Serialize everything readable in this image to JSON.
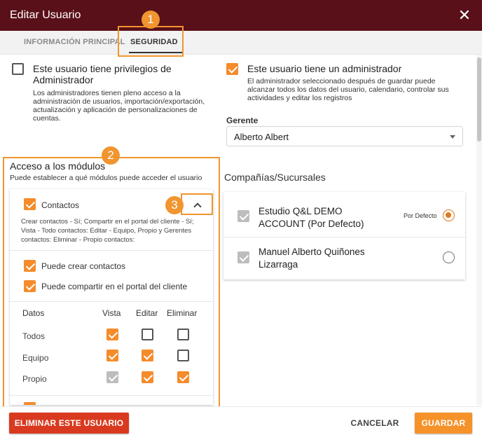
{
  "window": {
    "title": "Editar Usuario",
    "close_glyph": "✕"
  },
  "tabs": [
    {
      "label": "INFORMACIÓN PRINCIPAL",
      "active": false
    },
    {
      "label": "SEGURIDAD",
      "active": true
    }
  ],
  "admin_privileges": {
    "checked": false,
    "label_line1": "Este usuario tiene privilegios de",
    "label_line2": "Administrador",
    "description": "Los administradores tienen pleno acceso a la administración de usuarios, importación/exportación, actualización y aplicación de personalizaciones de cuentas."
  },
  "has_admin": {
    "checked": true,
    "label": "Este usuario tiene un administrador",
    "description": "El administrador seleccionado después de guardar puede alcanzar todos los datos del usuario, calendario, controlar sus actividades y editar los registros"
  },
  "manager": {
    "label": "Gerente",
    "value": "Alberto Albert"
  },
  "modules": {
    "title": "Acceso a los módulos",
    "subtitle": "Puede establecer a qué módulos puede acceder el usuario",
    "module_name": "Contactos",
    "module_checked": true,
    "summary": "Crear contactos - Sí; Compartir en el portal del cliente - Sí; Vista - Todo contactos: Editar - Equipo, Propio y Gerentes contactos: Eliminar - Propio contactos:",
    "options": [
      {
        "label": "Puede crear contactos",
        "checked": true
      },
      {
        "label": "Puede compartir en el portal del cliente",
        "checked": true
      }
    ],
    "table": {
      "headers": [
        "Datos",
        "Vista",
        "Editar",
        "Eliminar"
      ],
      "rows": [
        {
          "label": "Todos",
          "vista": "checked",
          "editar": "unchecked",
          "eliminar": "unchecked"
        },
        {
          "label": "Equipo",
          "vista": "checked",
          "editar": "checked",
          "eliminar": "unchecked"
        },
        {
          "label": "Propio",
          "vista": "grey",
          "editar": "checked",
          "eliminar": "checked"
        }
      ]
    }
  },
  "companies": {
    "title": "Compañías/Sucursales",
    "items": [
      {
        "name_line1": "Estudio Q&L DEMO",
        "name_line2": "ACCOUNT (Por Defecto)",
        "default_label": "Por Defecto",
        "selected": true
      },
      {
        "name_line1": "Manuel Alberto Quiñones",
        "name_line2": "Lizarraga",
        "default_label": "",
        "selected": false
      }
    ]
  },
  "annotations": [
    "1",
    "2",
    "3"
  ],
  "footer": {
    "delete_label": "ELIMINAR ESTE USUARIO",
    "cancel_label": "CANCELAR",
    "save_label": "GUARDAR"
  },
  "colors": {
    "titlebar": "#5a1019",
    "accent": "#f58b2a",
    "highlight": "#f0952f",
    "delete": "#d93a1f"
  }
}
